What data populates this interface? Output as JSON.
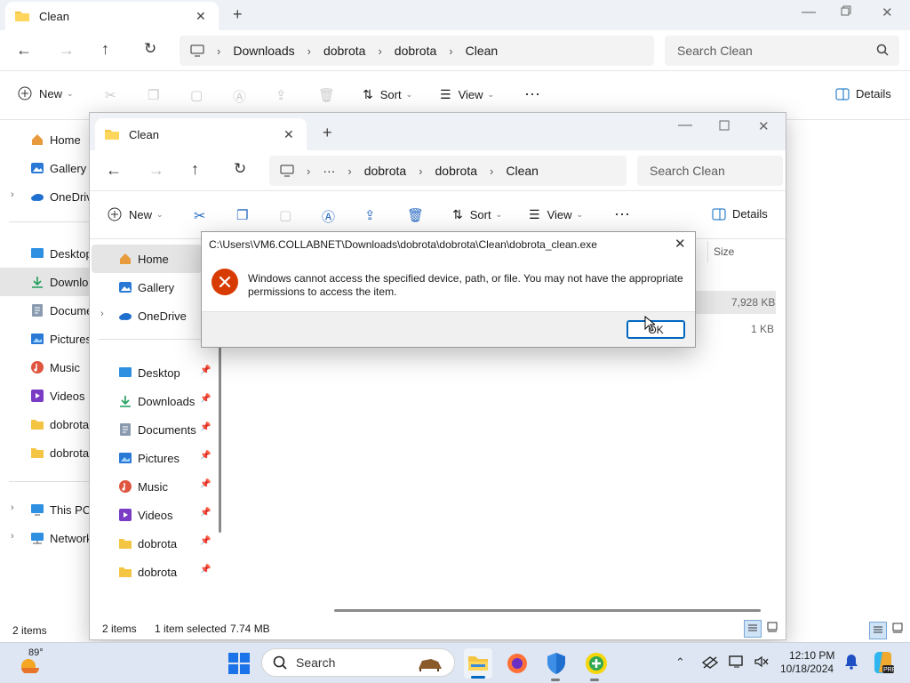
{
  "back_window": {
    "tab_title": "Clean",
    "breadcrumb": [
      "Downloads",
      "dobrota",
      "dobrota",
      "Clean"
    ],
    "search_placeholder": "Search Clean",
    "new_label": "New",
    "sort_label": "Sort",
    "view_label": "View",
    "details_label": "Details",
    "sidebar": [
      "Home",
      "Gallery",
      "OneDrive",
      "Desktop",
      "Downloads",
      "Documents",
      "Pictures",
      "Music",
      "Videos",
      "dobrota",
      "dobrota",
      "This PC",
      "Network"
    ],
    "status_items": "2 items"
  },
  "front_window": {
    "tab_title": "Clean",
    "breadcrumb": [
      "···",
      "dobrota",
      "dobrota",
      "Clean"
    ],
    "search_placeholder": "Search Clean",
    "new_label": "New",
    "sort_label": "Sort",
    "view_label": "View",
    "details_label": "Details",
    "sidebar_top": [
      "Home",
      "Gallery",
      "OneDrive"
    ],
    "sidebar_pinned": [
      "Desktop",
      "Downloads",
      "Documents",
      "Pictures",
      "Music",
      "Videos",
      "dobrota",
      "dobrota"
    ],
    "column_size": "Size",
    "file_sizes": [
      "7,928 KB",
      "1 KB"
    ],
    "status_items": "2 items",
    "status_selected": "1 item selected",
    "status_size": "7.74 MB"
  },
  "dialog": {
    "title": "C:\\Users\\VM6.COLLABNET\\Downloads\\dobrota\\dobrota\\Clean\\dobrota_clean.exe",
    "message": "Windows cannot access the specified device, path, or file. You may not have the appropriate permissions to access the item.",
    "ok_label": "OK"
  },
  "taskbar": {
    "weather_temp": "89°",
    "search_label": "Search",
    "time": "12:10 PM",
    "date": "10/18/2024"
  },
  "colors": {
    "accent": "#0067c0",
    "error_red": "#d83b01",
    "folder_yellow": "#f4c542"
  }
}
